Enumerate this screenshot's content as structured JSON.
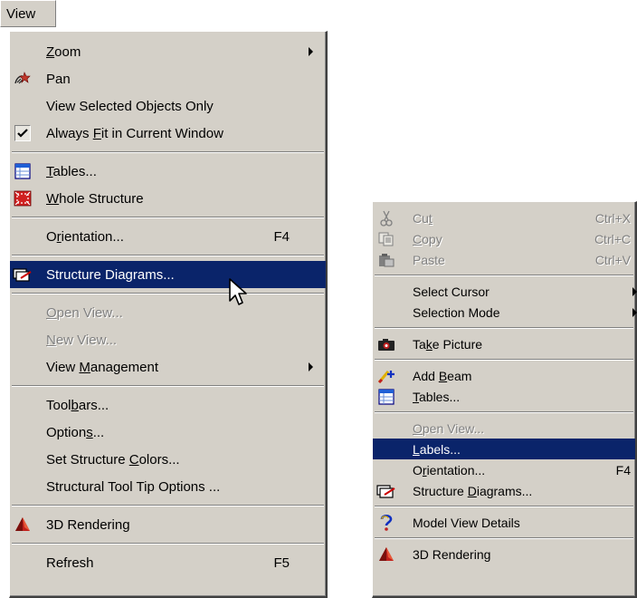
{
  "menubar": {
    "title": "View"
  },
  "view_menu": {
    "items": [
      {
        "label": "Zoom",
        "mnemonic": "Z",
        "submenu": true
      },
      {
        "label": "Pan",
        "icon": "pan-icon"
      },
      {
        "label": "View Selected Objects Only"
      },
      {
        "label": "Always Fit in Current Window",
        "mnemonic": "F",
        "checked": true
      },
      {
        "label": "Tables...",
        "mnemonic": "T",
        "icon": "tables-icon"
      },
      {
        "label": "Whole Structure",
        "mnemonic": "W",
        "icon": "whole-structure-icon"
      },
      {
        "label": "Orientation...",
        "mnemonic": "r",
        "shortcut": "F4"
      },
      {
        "label": "Structure Diagrams...",
        "icon": "structure-diagrams-icon",
        "highlighted": true
      },
      {
        "label": "Open View...",
        "mnemonic": "O",
        "disabled": true
      },
      {
        "label": "New View...",
        "mnemonic": "N",
        "disabled": true
      },
      {
        "label": "View Management",
        "mnemonic": "M",
        "submenu": true
      },
      {
        "label": "Toolbars...",
        "mnemonic": "b"
      },
      {
        "label": "Options...",
        "mnemonic": "s"
      },
      {
        "label": "Set Structure Colors...",
        "mnemonic": "C"
      },
      {
        "label": "Structural Tool Tip Options ..."
      },
      {
        "label": "3D Rendering",
        "icon": "3d-rendering-icon"
      },
      {
        "label": "Refresh",
        "shortcut": "F5"
      }
    ]
  },
  "context_menu": {
    "items": [
      {
        "label": "Cut",
        "mnemonic": "t",
        "shortcut": "Ctrl+X",
        "disabled": true,
        "icon": "scissors-icon"
      },
      {
        "label": "Copy",
        "mnemonic": "C",
        "shortcut": "Ctrl+C",
        "disabled": true,
        "icon": "copy-icon"
      },
      {
        "label": "Paste",
        "shortcut": "Ctrl+V",
        "disabled": true,
        "icon": "paste-icon"
      },
      {
        "label": "Select Cursor",
        "submenu": true
      },
      {
        "label": "Selection Mode",
        "submenu": true
      },
      {
        "label": "Take Picture",
        "mnemonic": "k",
        "icon": "camera-icon"
      },
      {
        "label": "Add Beam",
        "mnemonic": "B",
        "icon": "add-beam-icon"
      },
      {
        "label": "Tables...",
        "mnemonic": "T",
        "icon": "tables-icon"
      },
      {
        "label": "Open View...",
        "mnemonic": "O",
        "disabled": true
      },
      {
        "label": "Labels...",
        "mnemonic": "L",
        "highlighted": true
      },
      {
        "label": "Orientation...",
        "mnemonic": "r",
        "shortcut": "F4"
      },
      {
        "label": "Structure Diagrams...",
        "mnemonic": "D",
        "icon": "structure-diagrams-icon"
      },
      {
        "label": "Model View Details",
        "icon": "help-icon"
      },
      {
        "label": "3D Rendering",
        "icon": "3d-rendering-icon"
      }
    ]
  },
  "colors": {
    "menu_bg": "#d4d0c8",
    "highlight": "#0a246a",
    "disabled_text": "#808080"
  }
}
